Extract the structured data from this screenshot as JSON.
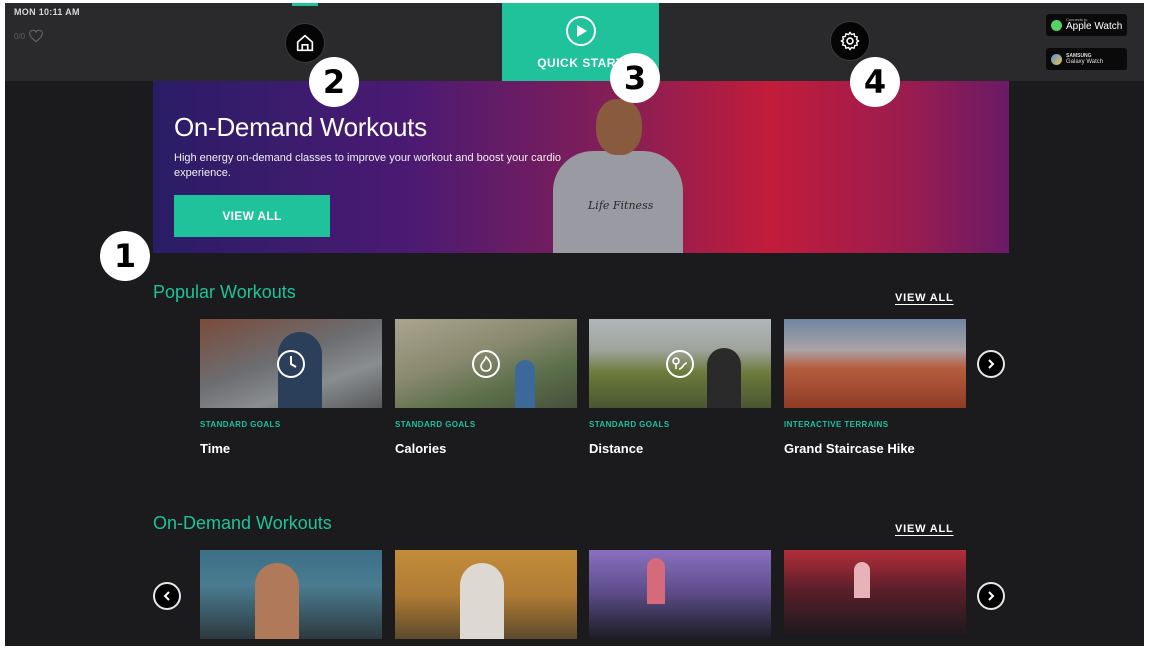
{
  "status": {
    "clock": "MON 10:11 AM",
    "heart_rate": "0/0"
  },
  "nav": {
    "quick_start_label": "QUICK START"
  },
  "watches": {
    "apple": {
      "small": "Connects to",
      "name": "Apple Watch"
    },
    "samsung": {
      "small": "SAMSUNG",
      "name": "Galaxy Watch"
    }
  },
  "hero": {
    "title": "On-Demand Workouts",
    "description": "High energy on-demand classes to improve your workout and boost your cardio experience.",
    "button_label": "VIEW ALL",
    "shirt_logo": "Life Fitness"
  },
  "markers": [
    "1",
    "2",
    "3",
    "4"
  ],
  "popular": {
    "title": "Popular Workouts",
    "view_all": "VIEW ALL",
    "cards": [
      {
        "category": "STANDARD GOALS",
        "name": "Time",
        "icon": "clock-icon"
      },
      {
        "category": "STANDARD GOALS",
        "name": "Calories",
        "icon": "flame-icon"
      },
      {
        "category": "STANDARD GOALS",
        "name": "Distance",
        "icon": "route-icon"
      },
      {
        "category": "INTERACTIVE TERRAINS",
        "name": "Grand Staircase Hike",
        "icon": ""
      }
    ]
  },
  "on_demand": {
    "title": "On-Demand Workouts",
    "view_all": "VIEW ALL"
  },
  "colors": {
    "accent": "#1fc29b",
    "background": "#1b1b1d",
    "topbar": "#2a2a2c"
  }
}
